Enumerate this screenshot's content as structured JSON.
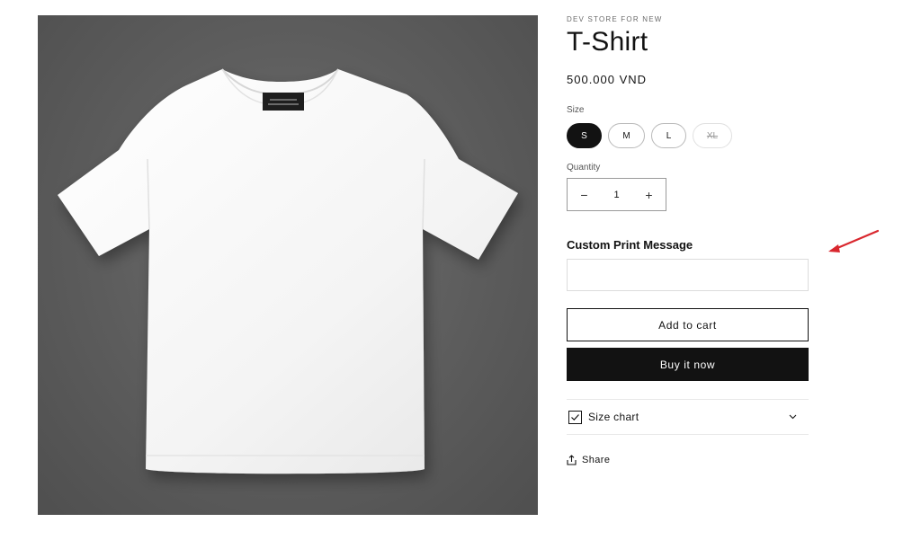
{
  "product": {
    "vendor": "DEV STORE FOR NEW",
    "title": "T-Shirt",
    "price": "500.000 VND",
    "image_alt": "White T-shirt mockup on grey background"
  },
  "size": {
    "label": "Size",
    "options": [
      {
        "label": "S",
        "state": "selected"
      },
      {
        "label": "M",
        "state": "available"
      },
      {
        "label": "L",
        "state": "available"
      },
      {
        "label": "XL",
        "state": "sold-out"
      }
    ]
  },
  "quantity": {
    "label": "Quantity",
    "value": "1",
    "minus": "−",
    "plus": "+"
  },
  "custom_print": {
    "label": "Custom Print Message",
    "value": "",
    "placeholder": ""
  },
  "buttons": {
    "add_to_cart": "Add to cart",
    "buy_now": "Buy it now"
  },
  "size_chart": {
    "label": "Size chart",
    "icon": "checkbox-icon"
  },
  "share": {
    "label": "Share",
    "icon": "share-icon"
  },
  "colors": {
    "primary": "#121212",
    "annotation": "#d9272e",
    "background": "#ffffff"
  }
}
